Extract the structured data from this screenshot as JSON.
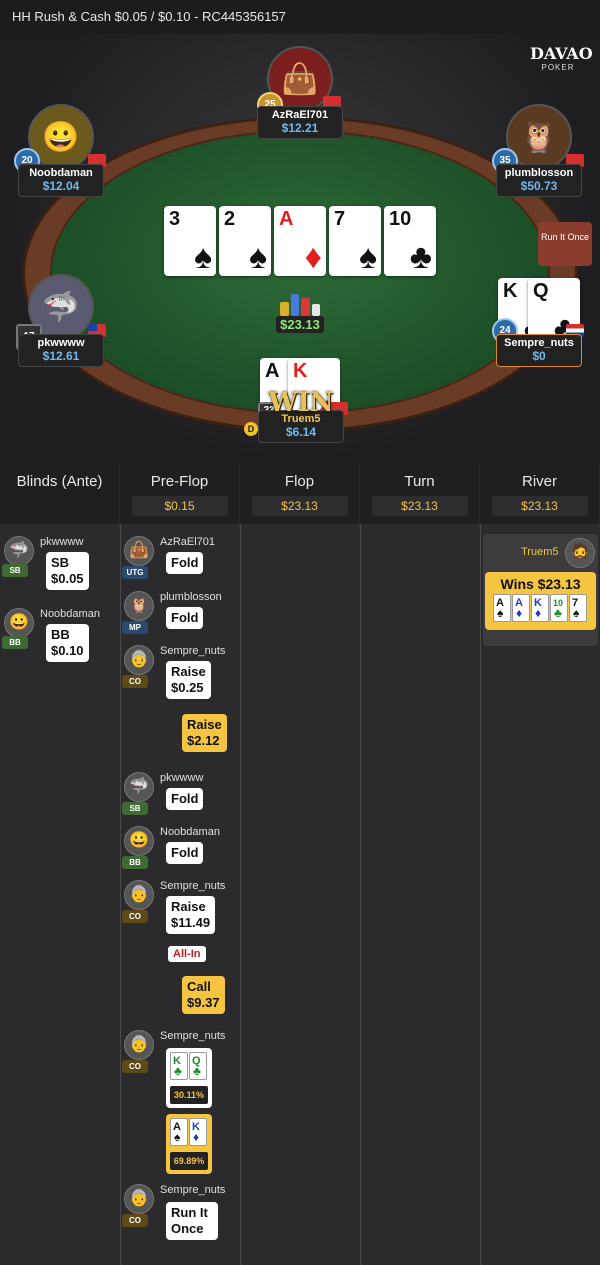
{
  "titlebar": {
    "text": "HH  Rush & Cash $0.05 / $0.10   - RC445356157"
  },
  "logo": {
    "line1": "DAVAO",
    "line2": "POKER"
  },
  "table": {
    "players": [
      {
        "id": "azraei",
        "name": "AzRaEl701",
        "stack": "$12.21",
        "level": "25",
        "avatar": "👜"
      },
      {
        "id": "noobdaman",
        "name": "Noobdaman",
        "stack": "$12.04",
        "level": "20",
        "avatar": "😀"
      },
      {
        "id": "plumblosson",
        "name": "plumblosson",
        "stack": "$50.73",
        "level": "35",
        "avatar": "🦉"
      },
      {
        "id": "pkwwww",
        "name": "pkwwww",
        "stack": "$12.61",
        "level": "17",
        "avatar": "🦈"
      },
      {
        "id": "sempre",
        "name": "Sempre_nuts",
        "stack": "$0",
        "level": "24",
        "avatar": ""
      },
      {
        "id": "truem5",
        "name": "Truem5",
        "stack": "$6.14",
        "level": "23",
        "avatar": ""
      }
    ],
    "board": [
      {
        "rank": "3",
        "suit": "♠",
        "color": "black"
      },
      {
        "rank": "2",
        "suit": "♠",
        "color": "black"
      },
      {
        "rank": "A",
        "suit": "♦",
        "color": "red"
      },
      {
        "rank": "7",
        "suit": "♠",
        "color": "black"
      },
      {
        "rank": "10",
        "suit": "♣",
        "color": "black"
      }
    ],
    "sempre_cards": [
      {
        "rank": "K",
        "suit": "♣"
      },
      {
        "rank": "Q",
        "suit": "♣"
      }
    ],
    "truem5_cards": [
      {
        "rank": "A",
        "suit": "♠",
        "color": "black"
      },
      {
        "rank": "K",
        "suit": "♦",
        "color": "red"
      }
    ],
    "pot": "$23.13",
    "run_it_once": "Run It Once",
    "win_text": "WIN",
    "dealer": "D"
  },
  "columns": [
    {
      "title": "Blinds (Ante)",
      "value": ""
    },
    {
      "title": "Pre-Flop",
      "value": "$0.15"
    },
    {
      "title": "Flop",
      "value": "$23.13"
    },
    {
      "title": "Turn",
      "value": "$23.13"
    },
    {
      "title": "River",
      "value": "$23.13"
    }
  ],
  "blinds": [
    {
      "name": "pkwwww",
      "pos": "SB",
      "action": "SB",
      "amount": "$0.05"
    },
    {
      "name": "Noobdaman",
      "pos": "BB",
      "action": "BB",
      "amount": "$0.10"
    }
  ],
  "preflop": [
    {
      "name": "AzRaEl701",
      "pos": "UTG",
      "action": "Fold"
    },
    {
      "name": "plumblosson",
      "pos": "MP",
      "action": "Fold"
    },
    {
      "name": "Sempre_nuts",
      "pos": "CO",
      "action": "Raise",
      "amount": "$0.25"
    },
    {
      "name": "",
      "pos": "",
      "action": "Raise",
      "amount": "$2.12"
    },
    {
      "name": "pkwwww",
      "pos": "SB",
      "action": "Fold"
    },
    {
      "name": "Noobdaman",
      "pos": "BB",
      "action": "Fold"
    },
    {
      "name": "Sempre_nuts",
      "pos": "CO",
      "action": "Raise",
      "amount": "$11.49",
      "tag": "All-In"
    },
    {
      "name": "",
      "pos": "",
      "action": "Call",
      "amount": "$9.37"
    },
    {
      "name": "Sempre_nuts",
      "pos": "CO",
      "cards": [
        {
          "rank": "K",
          "suit": "♣"
        },
        {
          "rank": "Q",
          "suit": "♣"
        }
      ],
      "equity": "30.11%"
    },
    {
      "name": "",
      "pos": "",
      "cards": [
        {
          "rank": "A",
          "suit": "♠"
        },
        {
          "rank": "K",
          "suit": "♦"
        }
      ],
      "equity": "69.89%"
    },
    {
      "name": "Sempre_nuts",
      "pos": "CO",
      "action": "Run It Once"
    }
  ],
  "river": {
    "winner": "Truem5",
    "win_label": "Wins $23.13",
    "cards": [
      {
        "rank": "A",
        "suit": "♠",
        "color": "black"
      },
      {
        "rank": "A",
        "suit": "♦",
        "color": "blue"
      },
      {
        "rank": "K",
        "suit": "♦",
        "color": "blue"
      },
      {
        "rank": "10",
        "suit": "♣",
        "color": "green"
      },
      {
        "rank": "7",
        "suit": "♠",
        "color": "black"
      }
    ]
  }
}
